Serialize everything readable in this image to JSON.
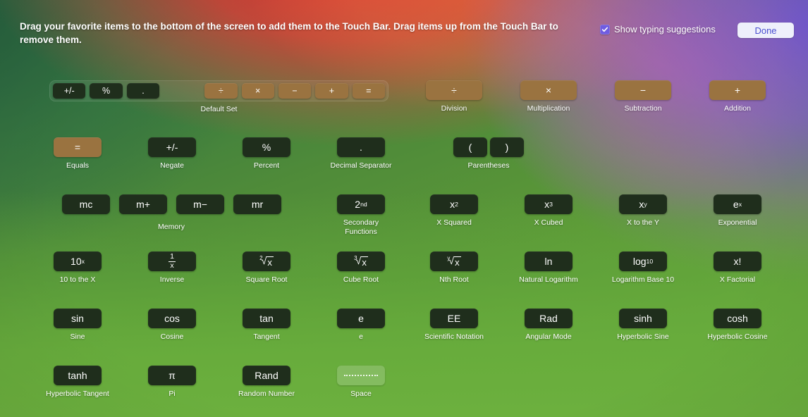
{
  "header": {
    "instructions": "Drag your favorite items to the bottom of the screen to add them to the Touch Bar. Drag items up from the Touch Bar to remove them.",
    "checkbox_label": "Show typing suggestions",
    "checkbox_checked": true,
    "done_label": "Done"
  },
  "colors": {
    "key_dark": "#1f2e1c",
    "key_tan": "#9a7340",
    "checkbox_accent": "#6f5ce0",
    "done_text": "#4a4fd0",
    "done_background": "#eef0fb"
  },
  "default_set": {
    "label": "Default Set",
    "dark_keys": [
      "+/-",
      "%",
      "."
    ],
    "tan_keys": [
      "÷",
      "×",
      "−",
      "+",
      "="
    ]
  },
  "items": [
    {
      "key": "÷",
      "label": "Division",
      "style": "tan"
    },
    {
      "key": "×",
      "label": "Multiplication",
      "style": "tan"
    },
    {
      "key": "−",
      "label": "Subtraction",
      "style": "tan"
    },
    {
      "key": "+",
      "label": "Addition",
      "style": "tan"
    },
    {
      "key": "=",
      "label": "Equals",
      "style": "tan"
    },
    {
      "key": "+/-",
      "label": "Negate",
      "style": "dark"
    },
    {
      "key": "%",
      "label": "Percent",
      "style": "dark"
    },
    {
      "key": ".",
      "label": "Decimal Separator",
      "style": "dark"
    },
    {
      "key": "( )",
      "label": "Parentheses",
      "style": "dark"
    },
    {
      "key": "mc",
      "label": "",
      "style": "dark"
    },
    {
      "key": "m+",
      "label": "",
      "style": "dark"
    },
    {
      "key": "m−",
      "label": "",
      "style": "dark"
    },
    {
      "key": "mr",
      "label": "Memory",
      "style": "dark"
    },
    {
      "key": "2nd",
      "label": "Secondary\nFunctions",
      "style": "dark"
    },
    {
      "key": "x2",
      "label": "X Squared",
      "style": "dark"
    },
    {
      "key": "x3",
      "label": "X Cubed",
      "style": "dark"
    },
    {
      "key": "xy",
      "label": "X to the Y",
      "style": "dark"
    },
    {
      "key": "ex",
      "label": "Exponential",
      "style": "dark"
    },
    {
      "key": "10x",
      "label": "10 to the X",
      "style": "dark"
    },
    {
      "key": "1/x",
      "label": "Inverse",
      "style": "dark"
    },
    {
      "key": "sqrt",
      "label": "Square Root",
      "style": "dark"
    },
    {
      "key": "cbrt",
      "label": "Cube Root",
      "style": "dark"
    },
    {
      "key": "nthrt",
      "label": "Nth Root",
      "style": "dark"
    },
    {
      "key": "ln",
      "label": "Natural Logarithm",
      "style": "dark"
    },
    {
      "key": "log10",
      "label": "Logarithm Base 10",
      "style": "dark"
    },
    {
      "key": "x!",
      "label": "X Factorial",
      "style": "dark"
    },
    {
      "key": "sin",
      "label": "Sine",
      "style": "dark"
    },
    {
      "key": "cos",
      "label": "Cosine",
      "style": "dark"
    },
    {
      "key": "tan",
      "label": "Tangent",
      "style": "dark"
    },
    {
      "key": "e",
      "label": "e",
      "style": "dark"
    },
    {
      "key": "EE",
      "label": "Scientific Notation",
      "style": "dark"
    },
    {
      "key": "Rad",
      "label": "Angular Mode",
      "style": "dark"
    },
    {
      "key": "sinh",
      "label": "Hyperbolic Sine",
      "style": "dark"
    },
    {
      "key": "cosh",
      "label": "Hyperbolic Cosine",
      "style": "dark"
    },
    {
      "key": "tanh",
      "label": "Hyperbolic Tangent",
      "style": "dark"
    },
    {
      "key": "π",
      "label": "Pi",
      "style": "dark"
    },
    {
      "key": "Rand",
      "label": "Random Number",
      "style": "dark"
    },
    {
      "key": "space",
      "label": "Space",
      "style": "space"
    }
  ],
  "labels": {
    "division": "Division",
    "multiplication": "Multiplication",
    "subtraction": "Subtraction",
    "addition": "Addition",
    "equals": "Equals",
    "negate": "Negate",
    "percent": "Percent",
    "decimal_separator": "Decimal Separator",
    "parentheses": "Parentheses",
    "memory": "Memory",
    "secondary_functions": "Secondary\nFunctions",
    "x_squared": "X Squared",
    "x_cubed": "X Cubed",
    "x_to_the_y": "X to the Y",
    "exponential": "Exponential",
    "ten_to_the_x": "10 to the X",
    "inverse": "Inverse",
    "square_root": "Square Root",
    "cube_root": "Cube Root",
    "nth_root": "Nth Root",
    "natural_logarithm": "Natural Logarithm",
    "logarithm_base_10": "Logarithm Base 10",
    "x_factorial": "X Factorial",
    "sine": "Sine",
    "cosine": "Cosine",
    "tangent": "Tangent",
    "e": "e",
    "scientific_notation": "Scientific Notation",
    "angular_mode": "Angular Mode",
    "hyperbolic_sine": "Hyperbolic Sine",
    "hyperbolic_cosine": "Hyperbolic Cosine",
    "hyperbolic_tangent": "Hyperbolic Tangent",
    "pi": "Pi",
    "random_number": "Random Number",
    "space": "Space"
  },
  "keycaps": {
    "divide": "÷",
    "multiply": "×",
    "minus": "−",
    "plus": "+",
    "equals": "=",
    "negate": "+/-",
    "percent": "%",
    "dot": ".",
    "paren_open": "(",
    "paren_close": ")",
    "mc": "mc",
    "m_plus": "m+",
    "m_minus": "m−",
    "mr": "mr",
    "second": "2",
    "second_sup": "nd",
    "x": "x",
    "sup2": "2",
    "sup3": "3",
    "supy": "y",
    "e": "e",
    "supx": "x",
    "ten": "10",
    "one": "1",
    "ln": "ln",
    "log": "log",
    "log_sub": "10",
    "x_factorial": "x!",
    "sin": "sin",
    "cos": "cos",
    "tan": "tan",
    "ee": "EE",
    "rad": "Rad",
    "sinh": "sinh",
    "cosh": "cosh",
    "tanh": "tanh",
    "pi": "π",
    "rand": "Rand"
  }
}
